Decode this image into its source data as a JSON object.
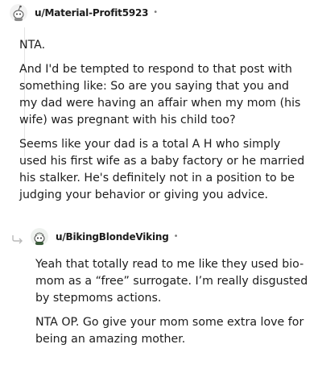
{
  "comments": [
    {
      "username": "u/Material-Profit5923",
      "separator": "•",
      "avatar_icon": "snoo-avatar-icon",
      "paragraphs": [
        "NTA.",
        "And I'd be tempted to respond to that post with something like: So are you saying that you and my dad were having an affair when my mom (his wife) was pregnant with his child too?",
        "Seems like your dad is a total A H who simply used his first wife as a baby factory or he married his stalker. He's definitely not in a position to be judging your behavior or giving you advice."
      ]
    },
    {
      "username": "u/BikingBlondeViking",
      "separator": "•",
      "avatar_icon": "snoo-avatar-icon",
      "reply_icon": "reply-arrow-icon",
      "paragraphs": [
        "Yeah that totally read to me like they used bio-mom as a “free” surrogate. I’m really disgusted by stepmoms actions.",
        "NTA OP. Go give your mom some extra love for being an amazing mother."
      ]
    }
  ]
}
